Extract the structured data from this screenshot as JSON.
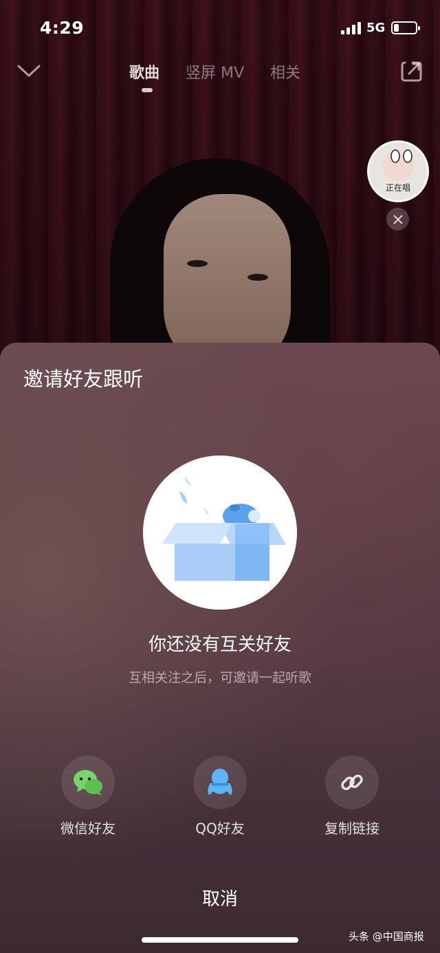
{
  "status_bar": {
    "time": "4:29",
    "network": "5G"
  },
  "top_bar": {
    "tabs": [
      {
        "label": "歌曲",
        "active": true
      },
      {
        "label": "竖屏 MV",
        "active": false
      },
      {
        "label": "相关",
        "active": false
      }
    ]
  },
  "singing_badge": {
    "label": "正在唱"
  },
  "sheet": {
    "title": "邀请好友跟听",
    "empty_title": "你还没有互关好友",
    "empty_subtitle": "互相关注之后，可邀请一起听歌",
    "options": [
      {
        "label": "微信好友",
        "icon": "wechat-icon"
      },
      {
        "label": "QQ好友",
        "icon": "qq-icon"
      },
      {
        "label": "复制链接",
        "icon": "link-icon"
      }
    ],
    "cancel_label": "取消"
  },
  "watermark": "头条 @中国商报",
  "colors": {
    "wechat": "#7bd36b",
    "qq": "#5db5f5",
    "illustration_blue": "#8ec1f7"
  }
}
